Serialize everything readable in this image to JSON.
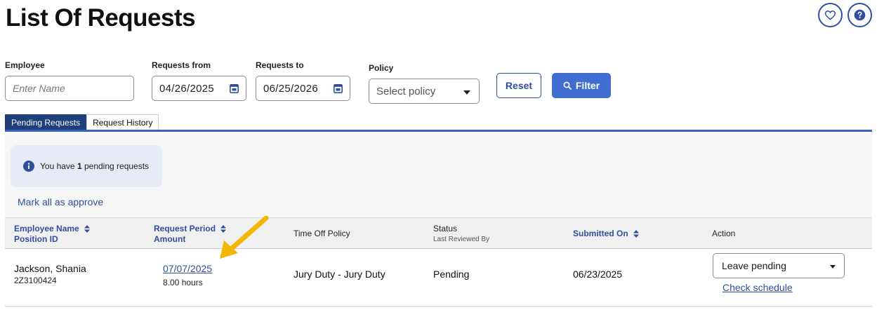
{
  "page": {
    "title": "List Of Requests"
  },
  "top_icons": [
    "heart-icon",
    "help-icon"
  ],
  "filters": {
    "employee": {
      "label": "Employee",
      "placeholder": "Enter Name"
    },
    "requests_from": {
      "label": "Requests from",
      "value": "04/26/2025"
    },
    "requests_to": {
      "label": "Requests to",
      "value": "06/25/2026"
    },
    "policy": {
      "label": "Policy",
      "value": "Select policy"
    },
    "reset_label": "Reset",
    "filter_label": "Filter"
  },
  "tabs": [
    {
      "label": "Pending Requests",
      "active": true
    },
    {
      "label": "Request History",
      "active": false
    }
  ],
  "info": {
    "prefix": "You have ",
    "count": "1",
    "suffix": " pending requests"
  },
  "mark_all_label": "Mark all as approve",
  "table": {
    "headers": {
      "employee": {
        "line1": "Employee Name",
        "line2": "Position ID"
      },
      "period": {
        "line1": "Request Period",
        "line2": "Amount"
      },
      "policy": {
        "line1": "Time Off Policy"
      },
      "status": {
        "line1": "Status",
        "line2": "Last Reviewed By"
      },
      "submitted": {
        "line1": "Submitted On"
      },
      "action": {
        "line1": "Action"
      }
    },
    "rows": [
      {
        "name": "Jackson, Shania",
        "position_id": "2Z3100424",
        "period": "07/07/2025",
        "amount": "8.00 hours",
        "policy": "Jury Duty - Jury Duty",
        "status": "Pending",
        "submitted": "06/23/2025",
        "action_value": "Leave pending",
        "check_schedule": "Check schedule"
      }
    ]
  },
  "colors": {
    "accent": "#2f4f9e",
    "filter_button": "#3f6ed0",
    "active_tab": "#1f3f7a",
    "annotation_arrow": "#f2b705"
  }
}
